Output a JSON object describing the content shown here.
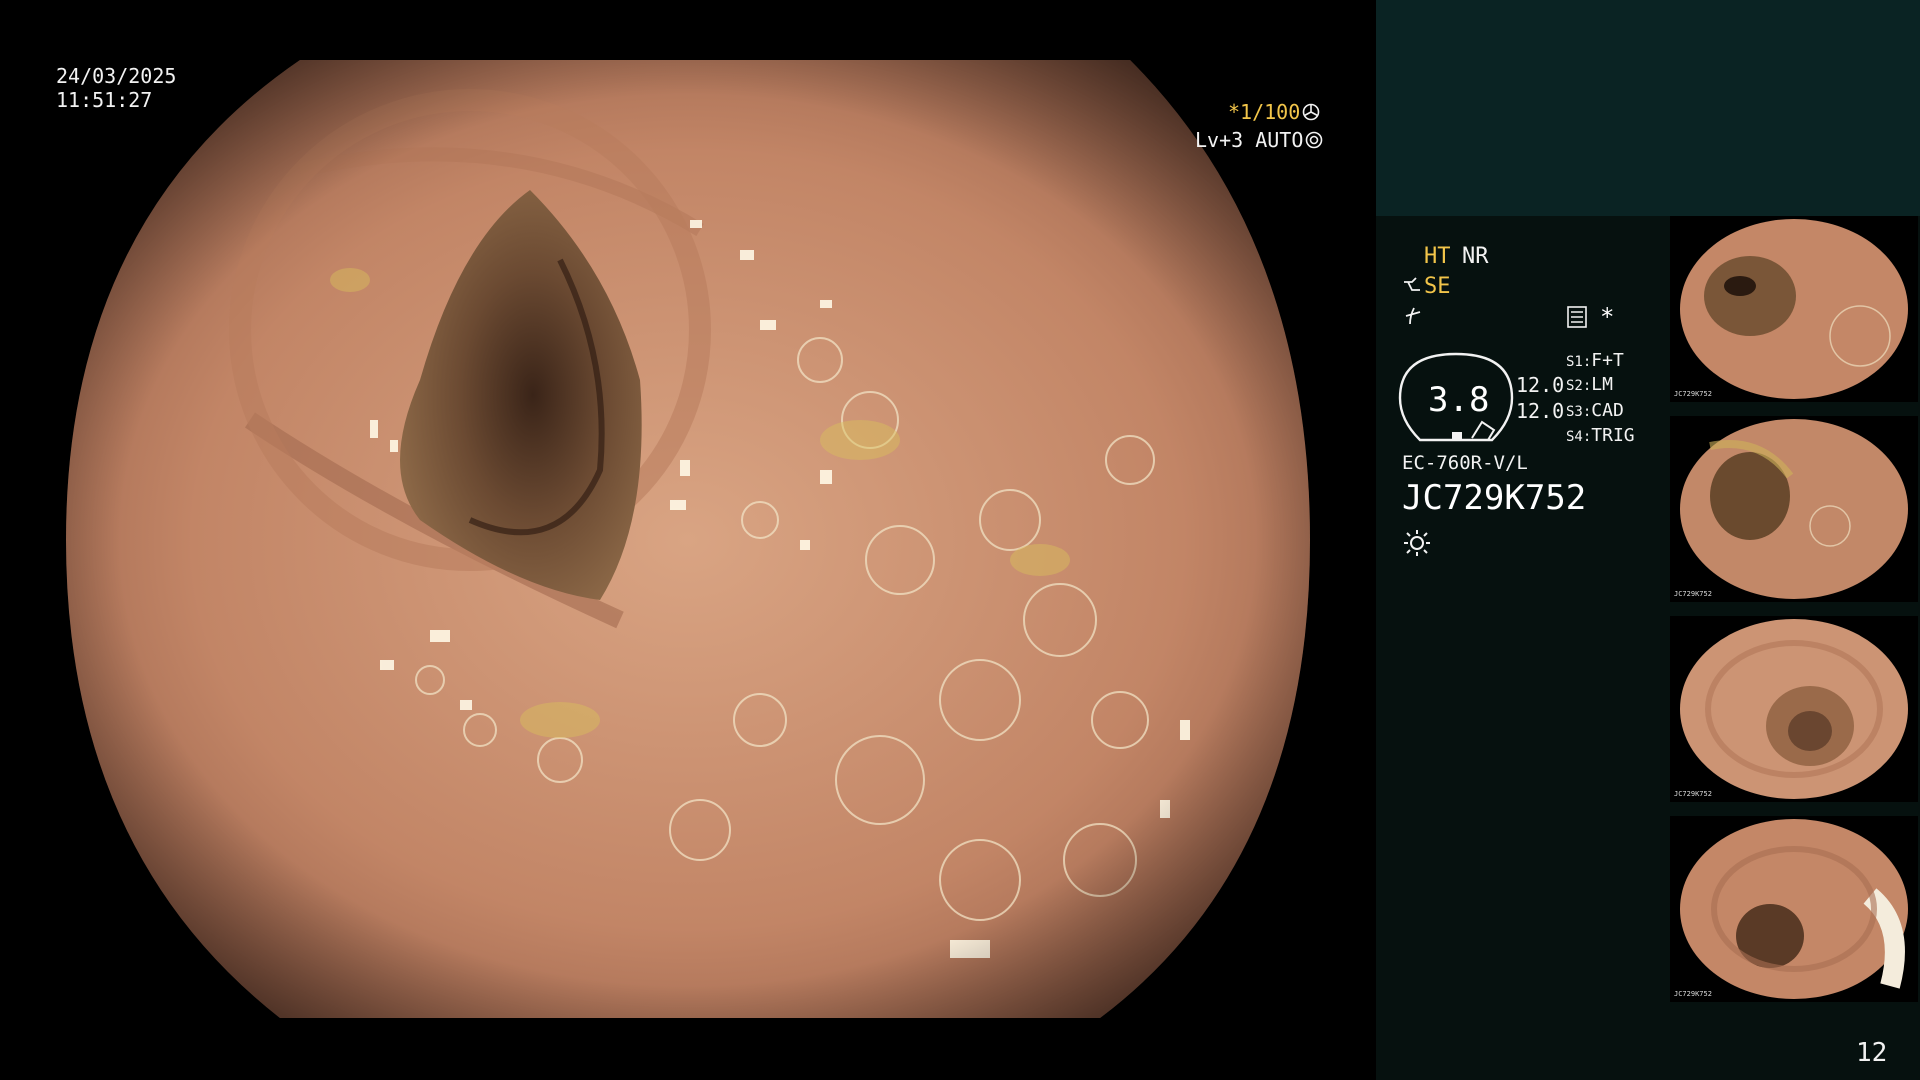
{
  "overlay": {
    "date": "24/03/2025",
    "time": "11:51:27",
    "shutter": "*1/100",
    "iris": "Lv+3 AUTO"
  },
  "panel": {
    "ht": "HT",
    "nr": "NR",
    "se": "SE",
    "gauge_value": "3.8",
    "value_1": "12.0",
    "value_2": "12.0",
    "slots": [
      {
        "key": "S1:",
        "label": "F+T"
      },
      {
        "key": "S2:",
        "label": "LM"
      },
      {
        "key": "S3:",
        "label": "CAD"
      },
      {
        "key": "S4:",
        "label": "TRIG"
      }
    ],
    "star": "*",
    "model": "EC-760R-V/L",
    "serial": "JC729K752",
    "page": "12"
  },
  "thumbnails": [
    {
      "serial": "JC729K752"
    },
    {
      "serial": "JC729K752"
    },
    {
      "serial": "JC729K752"
    },
    {
      "serial": "JC729K752"
    }
  ],
  "colors": {
    "accent_yellow": "#f2c54a",
    "panel_bg": "#06110f",
    "panel_top_bg": "#0a2323",
    "tissue": "#c68a6a"
  },
  "icons": [
    "shutter-icon",
    "iris-icon",
    "se-icon",
    "f-icon",
    "menu-icon",
    "light-icon"
  ]
}
